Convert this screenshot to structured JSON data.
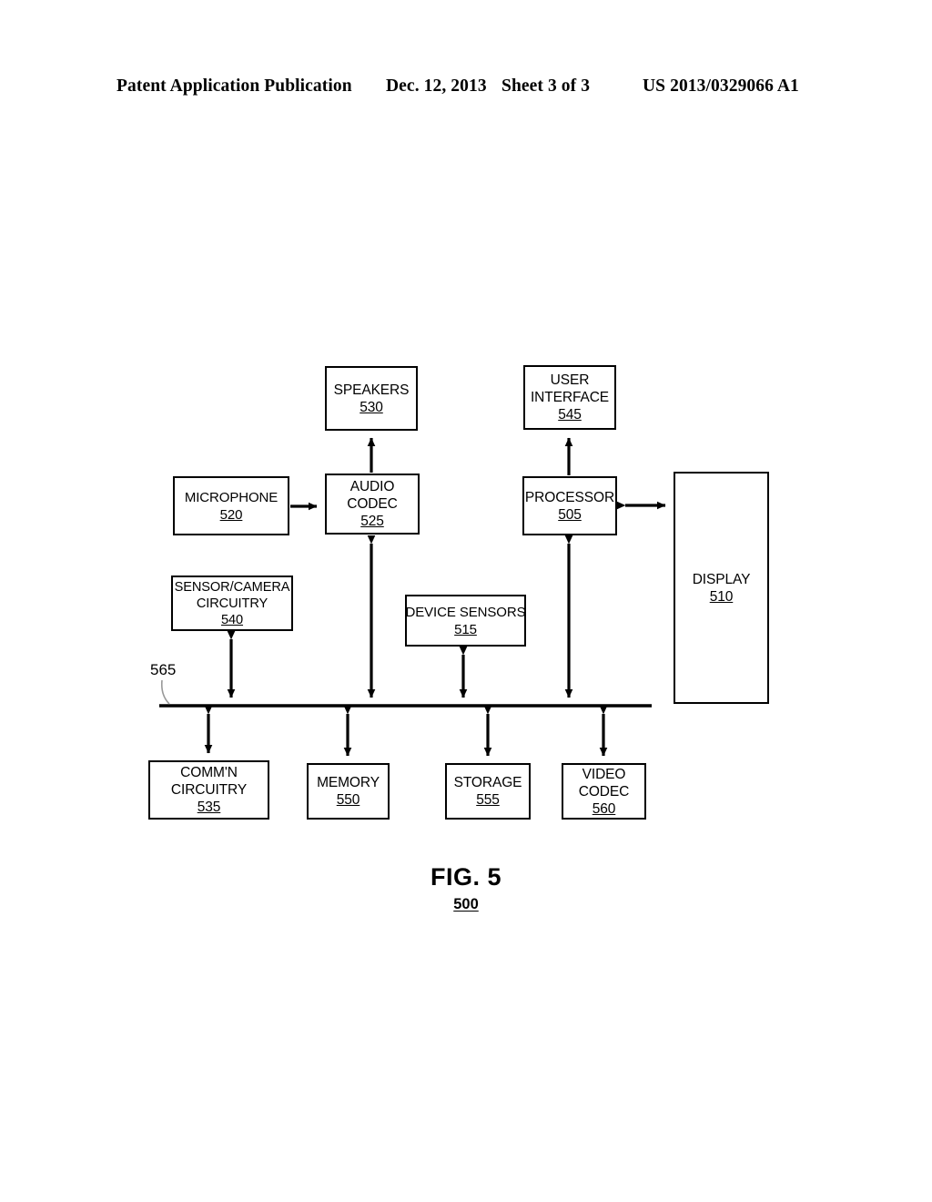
{
  "header": {
    "publication": "Patent Application Publication",
    "date": "Dec. 12, 2013",
    "sheet": "Sheet 3 of 3",
    "patent_number": "US 2013/0329066 A1"
  },
  "figure": {
    "caption_title": "FIG. 5",
    "caption_number": "500",
    "bus_label": "565",
    "boxes": {
      "speakers": {
        "label": "SPEAKERS",
        "number": "530"
      },
      "user_interface": {
        "label_line1": "USER",
        "label_line2": "INTERFACE",
        "number": "545"
      },
      "microphone": {
        "label": "MICROPHONE",
        "number": "520"
      },
      "audio_codec": {
        "label_line1": "AUDIO",
        "label_line2": "CODEC",
        "number": "525"
      },
      "processor": {
        "label": "PROCESSOR",
        "number": "505"
      },
      "display": {
        "label": "DISPLAY",
        "number": "510"
      },
      "sensor_camera": {
        "label_line1": "SENSOR/CAMERA",
        "label_line2": "CIRCUITRY",
        "number": "540"
      },
      "device_sensors": {
        "label": "DEVICE SENSORS",
        "number": "515"
      },
      "commn_circuitry": {
        "label_line1": "COMM'N",
        "label_line2": "CIRCUITRY",
        "number": "535"
      },
      "memory": {
        "label": "MEMORY",
        "number": "550"
      },
      "storage": {
        "label": "STORAGE",
        "number": "555"
      },
      "video_codec": {
        "label_line1": "VIDEO",
        "label_line2": "CODEC",
        "number": "560"
      }
    }
  },
  "colors": {
    "ink": "#000000",
    "paper": "#ffffff"
  }
}
